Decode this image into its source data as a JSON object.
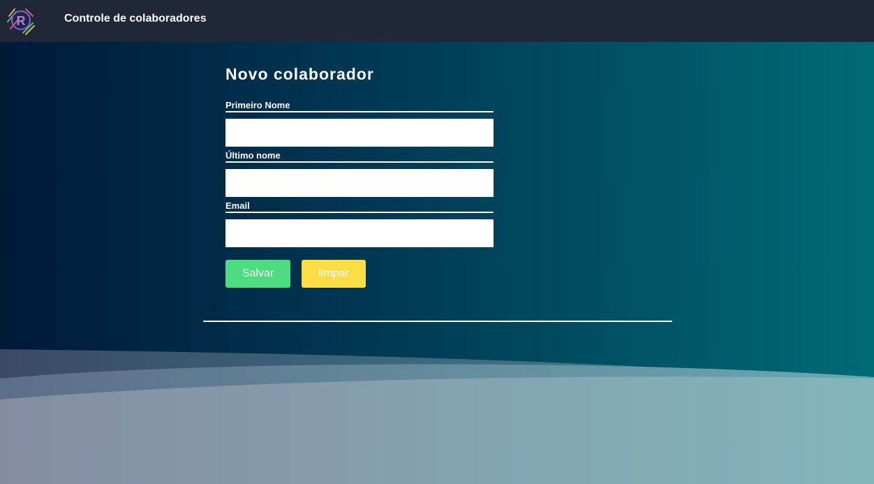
{
  "header": {
    "app_title": "Controle de colaboradores",
    "logo_icon": "r-logo-icon"
  },
  "form": {
    "title": "Novo colaborador",
    "fields": [
      {
        "label": "Primeiro Nome",
        "value": "",
        "placeholder": ""
      },
      {
        "label": "Último nome",
        "value": "",
        "placeholder": ""
      },
      {
        "label": "Email",
        "value": "",
        "placeholder": ""
      }
    ],
    "save_label": "Salvar",
    "clear_label": "limpar"
  },
  "colors": {
    "header_bg": "#202838",
    "save_button": "#4ddc7f",
    "clear_button": "#fddd45",
    "gradient_start": "#001a38",
    "gradient_end": "#006a75"
  }
}
